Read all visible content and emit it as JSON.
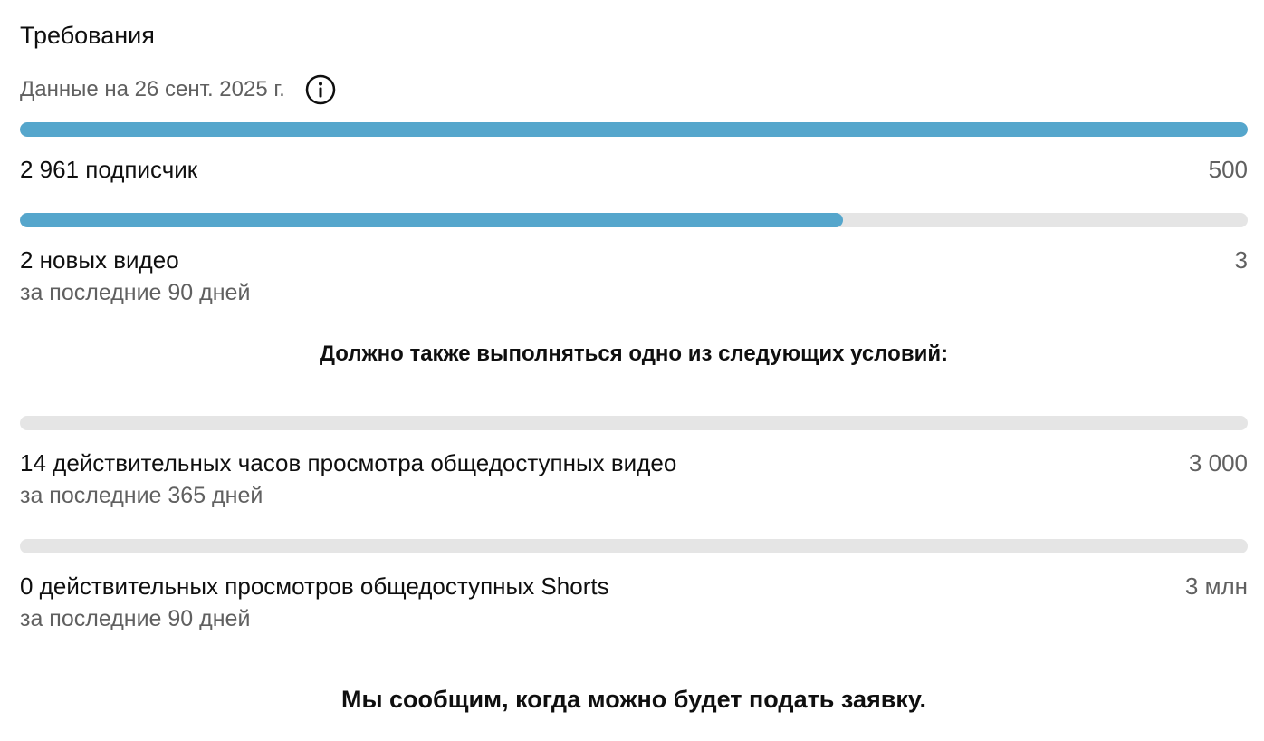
{
  "header": {
    "title": "Требования",
    "date_text": "Данные на 26 сент. 2025 г.",
    "info_icon": "info-icon"
  },
  "requirements": [
    {
      "label": "2 961 подписчик",
      "target": "500",
      "sublabel": "",
      "progress": 1.0
    },
    {
      "label": "2 новых видео",
      "target": "3",
      "sublabel": "за последние 90 дней",
      "progress": 0.67
    }
  ],
  "conditions_note": "Должно также выполняться одно из следующих условий:",
  "conditions": [
    {
      "label": "14 действительных часов просмотра общедоступных видео",
      "target": "3 000",
      "sublabel": "за последние 365 дней",
      "progress": 0.0
    },
    {
      "label": "0 действительных просмотров общедоступных Shorts",
      "target": "3 млн",
      "sublabel": "за последние 90 дней",
      "progress": 0.0
    }
  ],
  "footer_note": "Мы сообщим, когда можно будет подать заявку.",
  "colors": {
    "progress_fill": "#55a6cc",
    "progress_track": "#e5e5e5",
    "secondary_text": "#606060"
  }
}
